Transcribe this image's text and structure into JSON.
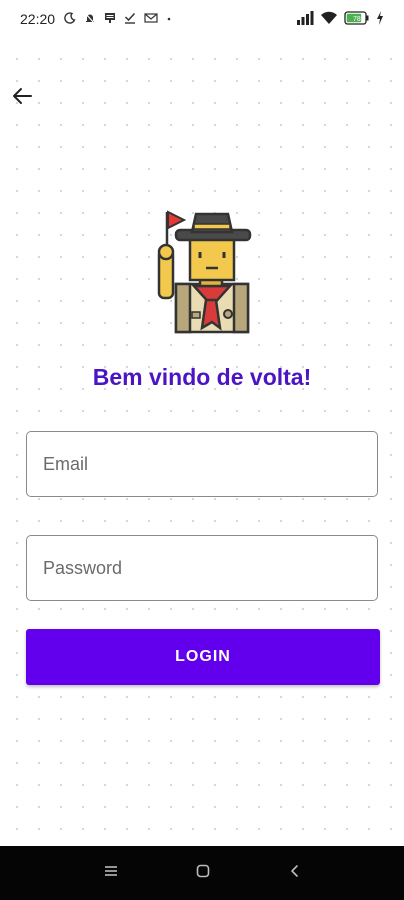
{
  "status_bar": {
    "time": "22:20",
    "left_icons": [
      "moon-icon",
      "notification-icon",
      "message-icon",
      "check-icon",
      "mail-icon",
      "dot-icon"
    ],
    "right_icons": [
      "signal-icon",
      "wifi-icon",
      "battery-icon",
      "charging-icon"
    ],
    "battery_level": "78"
  },
  "header": {
    "back_icon": "arrow-left-icon"
  },
  "mascot": {
    "icon": "scout-icon",
    "colors": {
      "hat": "#4a4a4a",
      "hat_band": "#f2c94c",
      "skin": "#f2c94c",
      "shirt": "#e9dcb3",
      "shirt_dark": "#b8a77a",
      "scarf": "#d93b3b",
      "flag": "#e53935"
    }
  },
  "login": {
    "title": "Bem vindo de volta!",
    "email_placeholder": "Email",
    "password_placeholder": "Password",
    "button_label": "LOGIN"
  },
  "colors": {
    "accent": "#6200ee",
    "title": "#4b14c4",
    "field_border": "#8a8a8a",
    "nav_background": "#050505"
  },
  "nav_bar": {
    "buttons": [
      "menu-icon",
      "home-icon",
      "back-icon"
    ]
  }
}
